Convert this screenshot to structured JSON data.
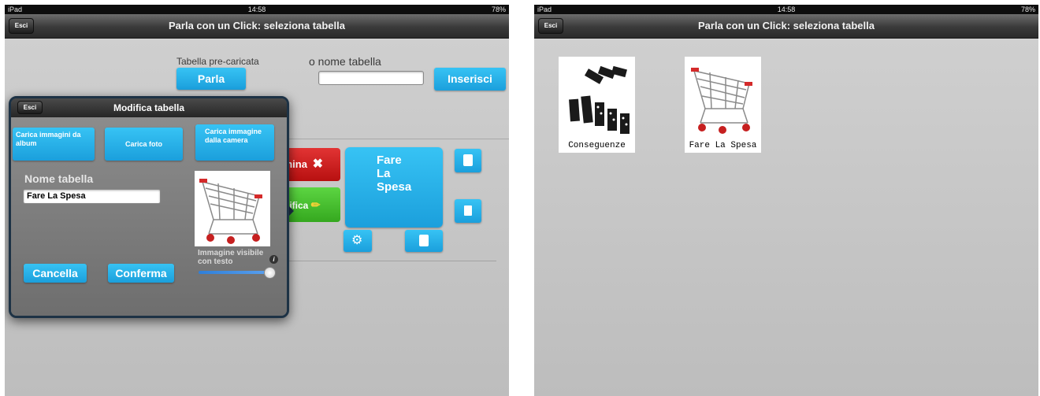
{
  "left": {
    "status": {
      "carrier": "iPad",
      "time": "14:58",
      "battery": "78%"
    },
    "nav": {
      "title": "Parla con un Click: seleziona tabella",
      "exit_label": "Esci"
    },
    "form": {
      "preloaded_label": "Tabella pre-caricata",
      "preloaded_button": "Parla",
      "name_label": "o nome tabella",
      "name_value": "",
      "insert_button": "Inserisci"
    },
    "background_tile": {
      "delete_label": "imina",
      "edit_label": "difica",
      "tile_text": "Fare La Spesa"
    },
    "popup": {
      "title": "Modifica tabella",
      "exit_label": "Esci",
      "load_album": "Carica immagini da album",
      "load_photo": "Carica foto",
      "load_camera": "Carica immagine dalla camera",
      "name_label": "Nome tabella",
      "name_value": "Fare La Spesa",
      "visible_label": "Immagine visibile con testo",
      "info": "i",
      "cancel": "Cancella",
      "confirm": "Conferma",
      "visible_slider_value": 1.0
    }
  },
  "right": {
    "status": {
      "carrier": "iPad",
      "time": "14:58",
      "battery": "78%"
    },
    "nav": {
      "title": "Parla con un Click: seleziona tabella",
      "exit_label": "Esci"
    },
    "tiles": [
      {
        "label": "Conseguenze",
        "icon": "dominoes-icon"
      },
      {
        "label": "Fare La Spesa",
        "icon": "shopping-cart-icon"
      }
    ]
  },
  "colors": {
    "accent_blue": "#1fa6e0",
    "delete_red": "#cc1b1b",
    "edit_green": "#3fbf2a",
    "popup_border": "#1d3245"
  }
}
